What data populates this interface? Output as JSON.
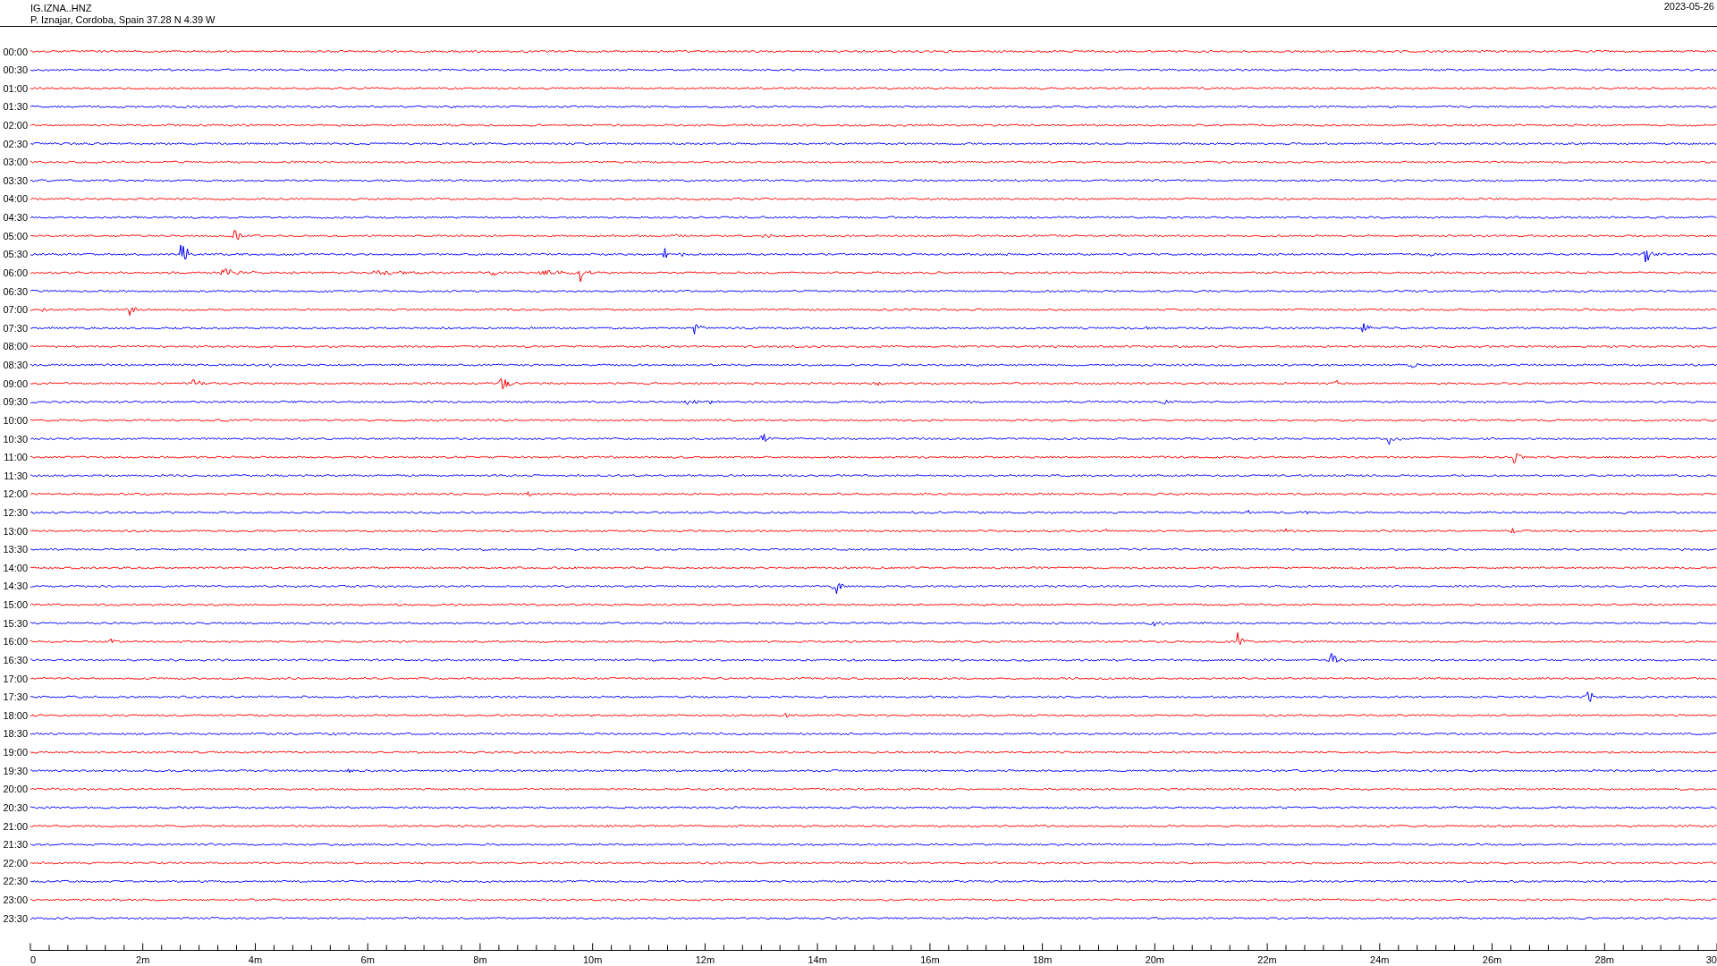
{
  "header": {
    "station": "IG.IZNA..HNZ",
    "location": "P. Iznajar, Cordoba, Spain  37.28 N 4.39 W",
    "date": "2023-05-26"
  },
  "traces": [
    {
      "time": "00:00",
      "color": "#ff0000"
    },
    {
      "time": "00:30",
      "color": "#0000ff"
    },
    {
      "time": "01:00",
      "color": "#ff0000"
    },
    {
      "time": "01:30",
      "color": "#0000ff"
    },
    {
      "time": "02:00",
      "color": "#ff0000"
    },
    {
      "time": "02:30",
      "color": "#0000ff"
    },
    {
      "time": "03:00",
      "color": "#ff0000"
    },
    {
      "time": "03:30",
      "color": "#0000ff"
    },
    {
      "time": "04:00",
      "color": "#ff0000"
    },
    {
      "time": "04:30",
      "color": "#0000ff"
    },
    {
      "time": "05:00",
      "color": "#ff0000"
    },
    {
      "time": "05:30",
      "color": "#0000ff"
    },
    {
      "time": "06:00",
      "color": "#ff0000"
    },
    {
      "time": "06:30",
      "color": "#0000ff"
    },
    {
      "time": "07:00",
      "color": "#ff0000"
    },
    {
      "time": "07:30",
      "color": "#0000ff"
    },
    {
      "time": "08:00",
      "color": "#ff0000"
    },
    {
      "time": "08:30",
      "color": "#0000ff"
    },
    {
      "time": "09:00",
      "color": "#ff0000"
    },
    {
      "time": "09:30",
      "color": "#0000ff"
    },
    {
      "time": "10:00",
      "color": "#ff0000"
    },
    {
      "time": "10:30",
      "color": "#0000ff"
    },
    {
      "time": "11:00",
      "color": "#ff0000"
    },
    {
      "time": "11:30",
      "color": "#0000ff"
    },
    {
      "time": "12:00",
      "color": "#ff0000"
    },
    {
      "time": "12:30",
      "color": "#0000ff"
    },
    {
      "time": "13:00",
      "color": "#ff0000"
    },
    {
      "time": "13:30",
      "color": "#0000ff"
    },
    {
      "time": "14:00",
      "color": "#ff0000"
    },
    {
      "time": "14:30",
      "color": "#0000ff"
    },
    {
      "time": "15:00",
      "color": "#ff0000"
    },
    {
      "time": "15:30",
      "color": "#0000ff"
    },
    {
      "time": "16:00",
      "color": "#ff0000"
    },
    {
      "time": "16:30",
      "color": "#0000ff"
    },
    {
      "time": "17:00",
      "color": "#ff0000"
    },
    {
      "time": "17:30",
      "color": "#0000ff"
    },
    {
      "time": "18:00",
      "color": "#ff0000"
    },
    {
      "time": "18:30",
      "color": "#0000ff"
    },
    {
      "time": "19:00",
      "color": "#ff0000"
    },
    {
      "time": "19:30",
      "color": "#0000ff"
    },
    {
      "time": "20:00",
      "color": "#ff0000"
    },
    {
      "time": "20:30",
      "color": "#0000ff"
    },
    {
      "time": "21:00",
      "color": "#ff0000"
    },
    {
      "time": "21:30",
      "color": "#0000ff"
    },
    {
      "time": "22:00",
      "color": "#ff0000"
    },
    {
      "time": "22:30",
      "color": "#0000ff"
    },
    {
      "time": "23:00",
      "color": "#ff0000"
    },
    {
      "time": "23:30",
      "color": "#0000ff"
    }
  ],
  "x_axis": {
    "labels": [
      "0",
      "2m",
      "4m",
      "6m",
      "8m",
      "10m",
      "12m",
      "14m",
      "16m",
      "18m",
      "20m",
      "22m",
      "24m",
      "26m",
      "28m",
      "30"
    ]
  }
}
